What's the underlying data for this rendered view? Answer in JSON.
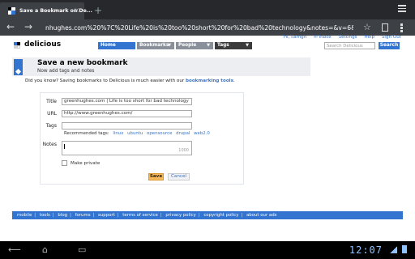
{
  "browser": {
    "tab_title": "Save a Bookmark on De...",
    "tab_close": "×",
    "new_tab": "+",
    "url": "nhughes.com%20%7C%20Life%20is%20too%20short%20for%20bad%20technology&notes=&v=6&jump=yes",
    "back_glyph": "←",
    "forward_glyph": "→",
    "star_glyph": "☆"
  },
  "site": {
    "logo_text": "delicious",
    "logo_colors": [
      "#3274d0",
      "#000000",
      "#d3d3d3",
      "#ffffff"
    ],
    "nav_tabs": [
      {
        "label": "Home",
        "color": "#3274d0"
      },
      {
        "label": "Bookmarks",
        "color": "#8a9099",
        "arrow": "▼"
      },
      {
        "label": "People",
        "color": "#8a9099",
        "arrow": "▼"
      },
      {
        "label": "Tags",
        "color": "#3b3b3b",
        "arrow": "▼"
      }
    ],
    "top_links": {
      "greeting": "Hi, llamgh",
      "inbox": "Inbox",
      "settings": "Settings",
      "help": "Help",
      "signout": "Sign Out"
    },
    "search_placeholder": "Search Delicious",
    "search_button": "Search"
  },
  "page": {
    "title": "Save a new bookmark",
    "subtitle": "Now add tags and notes",
    "did_you_know": "Did you know? Saving bookmarks to Delicious is much easier with our",
    "did_you_know_link": "bookmarking tools",
    "did_you_know_end": "."
  },
  "form": {
    "title_label": "Title",
    "title_value": "greenhughes.com | Life is too short for bad technology",
    "url_label": "URL",
    "url_value": "http://www.greenhughes.com/",
    "tags_label": "Tags",
    "tags_value": "",
    "recommended_label": "Recommended tags:",
    "recommended_tags": [
      "linux",
      "ubuntu",
      "opensource",
      "drupal",
      "web2.0"
    ],
    "notes_label": "Notes",
    "notes_value": "",
    "notes_counter": "1000",
    "private_label": "Make private",
    "save_button": "Save",
    "cancel_button": "Cancel"
  },
  "footer": {
    "links": [
      "mobile",
      "tools",
      "blog",
      "forums",
      "support",
      "terms of service",
      "privacy policy",
      "copyright policy",
      "about our ads"
    ]
  },
  "system": {
    "clock": "12:07",
    "back_glyph": "⟵",
    "home_glyph": "⌂",
    "recent_glyph": "▭"
  }
}
